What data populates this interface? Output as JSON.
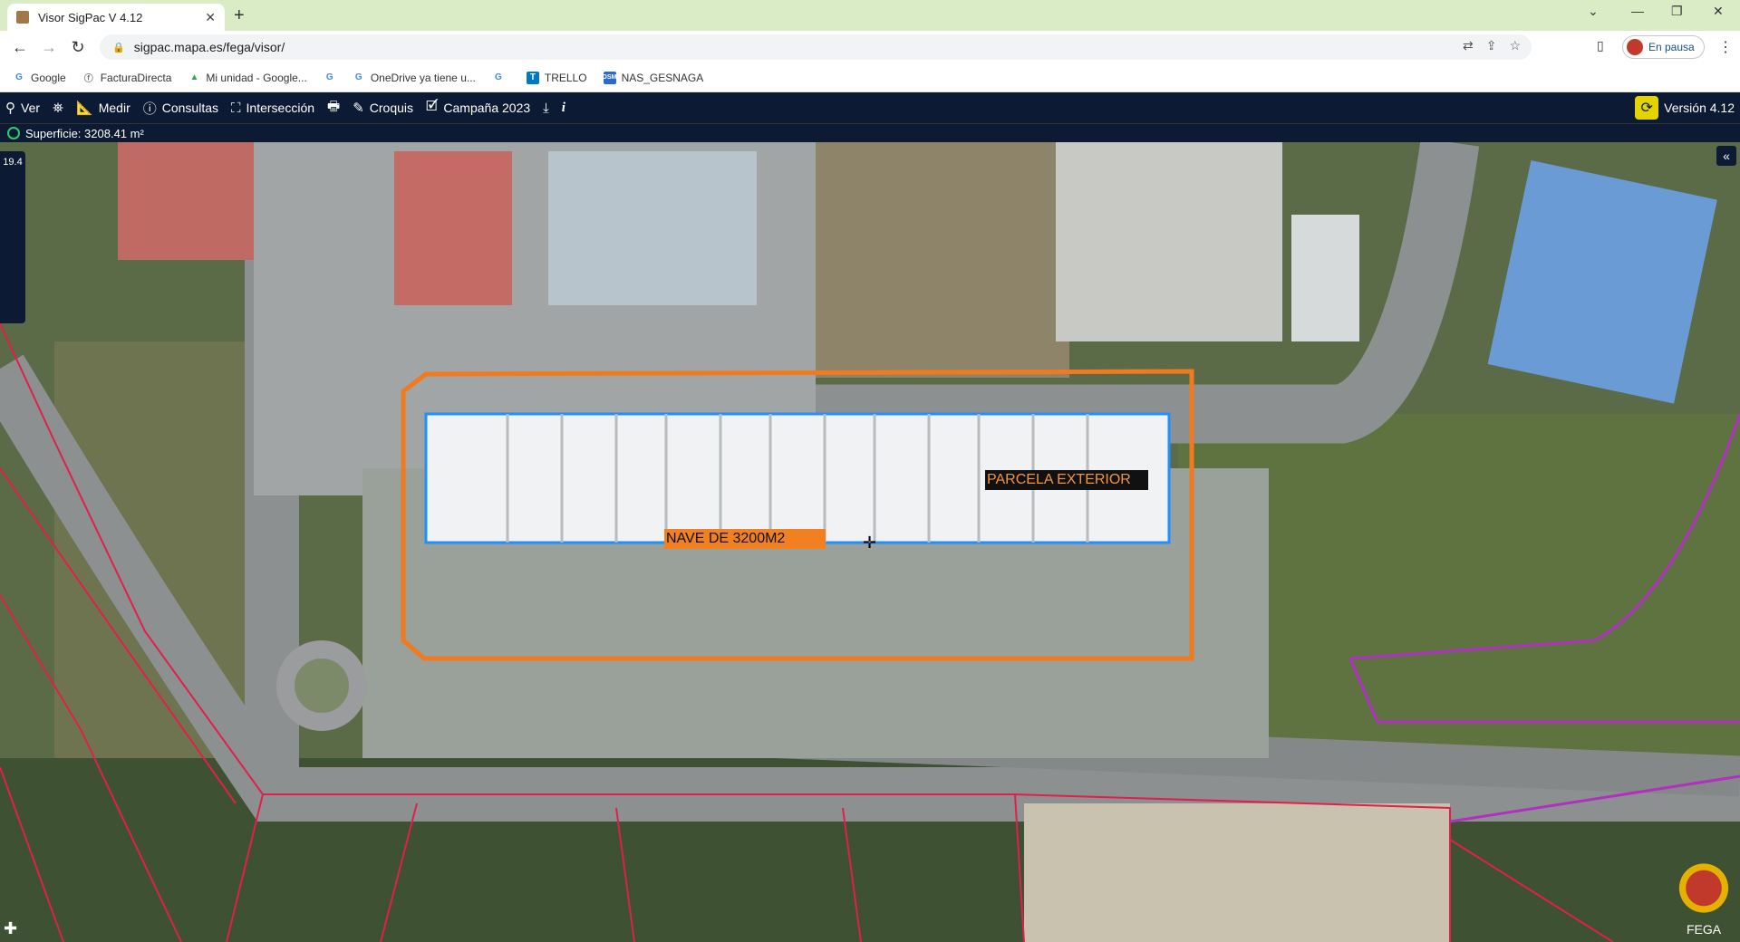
{
  "browser": {
    "tab_title": "Visor SigPac V 4.12",
    "url": "sigpac.mapa.es/fega/visor/",
    "profile_status": "En pausa",
    "bookmarks": [
      {
        "label": "Google"
      },
      {
        "label": "FacturaDirecta"
      },
      {
        "label": "Mi unidad - Google..."
      },
      {
        "label": "OneDrive ya tiene u..."
      },
      {
        "label": ""
      },
      {
        "label": "TRELLO"
      },
      {
        "label": "NAS_GESNAGA"
      }
    ]
  },
  "toolbar": {
    "ver": "Ver",
    "medir": "Medir",
    "consultas": "Consultas",
    "interseccion": "Intersección",
    "croquis": "Croquis",
    "campana": "Campaña 2023",
    "info": "i",
    "version": "Versión 4.12"
  },
  "status": {
    "superficie": "Superficie: 3208.41 m²"
  },
  "map": {
    "scale_label": "19.4",
    "label_nave": "NAVE  DE  3200M2",
    "label_parcela": "PARCELA EXTERIOR",
    "attribution": "FEGA",
    "colors": {
      "parcel_outline": "#f07a1e",
      "building_outline": "#1e90ff",
      "cadastre_lines": "#e0204a",
      "boundary_line": "#b030c0"
    }
  }
}
